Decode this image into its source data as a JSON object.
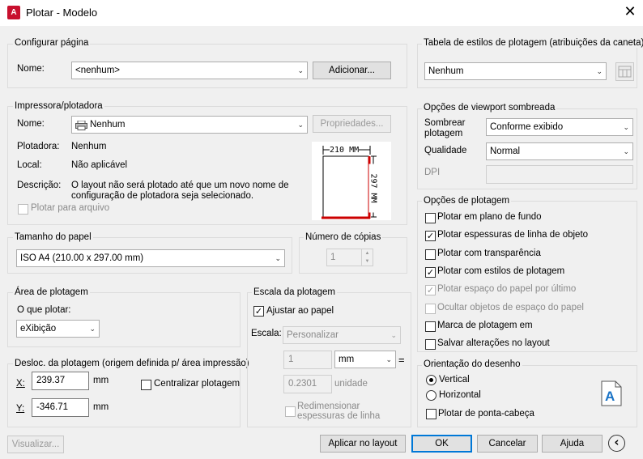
{
  "window": {
    "title": "Plotar - Modelo",
    "app_icon_label": "A"
  },
  "page_setup": {
    "group_label": "Configurar página",
    "name_label": "Nome:",
    "name_value": "<nenhum>",
    "add_button": "Adicionar..."
  },
  "printer": {
    "group_label": "Impressora/plotadora",
    "name_label": "Nome:",
    "name_value": "Nenhum",
    "properties_button": "Propriedades...",
    "plotter_label": "Plotadora:",
    "plotter_value": "Nenhum",
    "local_label": "Local:",
    "local_value": "Não aplicável",
    "description_label": "Descrição:",
    "description_value": "O layout não será plotado até que um novo nome de configuração de plotadora seja selecionado.",
    "plot_to_file": "Plotar para arquivo",
    "preview_width": "210 MM",
    "preview_height": "297 MM"
  },
  "paper_size": {
    "group_label": "Tamanho do papel",
    "value": "ISO A4 (210.00 x 297.00 mm)"
  },
  "copies": {
    "group_label": "Número de cópias",
    "value": "1"
  },
  "plot_area": {
    "group_label": "Área de plotagem",
    "what_label": "O que plotar:",
    "what_value": "eXibição"
  },
  "plot_offset": {
    "group_label": "Desloc. da plotagem (origem definida p/ área impressão)",
    "x_label": "X:",
    "x_value": "239.37",
    "y_label": "Y:",
    "y_value": "-346.71",
    "unit": "mm",
    "center_label": "Centralizar plotagem"
  },
  "plot_scale": {
    "group_label": "Escala da plotagem",
    "fit_label": "Ajustar ao papel",
    "scale_label": "Escala:",
    "scale_value": "Personalizar",
    "value1": "1",
    "unit1": "mm",
    "equals": "=",
    "value2": "0.2301",
    "unit2": "unidade",
    "scale_lineweights": "Redimensionar espessuras de linha"
  },
  "plot_style_table": {
    "group_label": "Tabela de estilos de plotagem (atribuições da caneta)",
    "value": "Nenhum"
  },
  "shaded_viewport": {
    "group_label": "Opções de viewport sombreada",
    "shade_label": "Sombrear plotagem",
    "shade_value": "Conforme exibido",
    "quality_label": "Qualidade",
    "quality_value": "Normal",
    "dpi_label": "DPI",
    "dpi_value": ""
  },
  "plot_options": {
    "group_label": "Opções de plotagem",
    "items": [
      {
        "label": "Plotar em plano de fundo",
        "checked": false,
        "enabled": true
      },
      {
        "label": "Plotar espessuras de linha de objeto",
        "checked": true,
        "enabled": true
      },
      {
        "label": "Plotar com transparência",
        "checked": false,
        "enabled": true
      },
      {
        "label": "Plotar com estilos de plotagem",
        "checked": true,
        "enabled": true
      },
      {
        "label": "Plotar espaço do papel por último",
        "checked": true,
        "enabled": false
      },
      {
        "label": "Ocultar objetos de espaço do papel",
        "checked": false,
        "enabled": false
      },
      {
        "label": "Marca de plotagem em",
        "checked": false,
        "enabled": true
      },
      {
        "label": "Salvar alterações no layout",
        "checked": false,
        "enabled": true
      }
    ]
  },
  "orientation": {
    "group_label": "Orientação do desenho",
    "portrait": "Vertical",
    "landscape": "Horizontal",
    "upside_down": "Plotar de ponta-cabeça",
    "selected": "Vertical",
    "icon_letter": "A"
  },
  "footer": {
    "preview": "Visualizar...",
    "apply": "Aplicar no layout",
    "ok": "OK",
    "cancel": "Cancelar",
    "help": "Ajuda",
    "more_icon": "‹"
  },
  "colors": {
    "accent": "#0078d7",
    "paper_red": "#cc0000",
    "app_red": "#c8102e"
  }
}
